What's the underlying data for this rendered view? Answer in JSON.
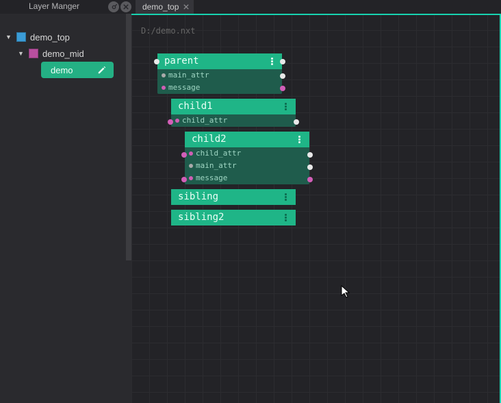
{
  "panel": {
    "title": "Layer Manger"
  },
  "tab": {
    "label": "demo_top"
  },
  "tree": {
    "top": {
      "label": "demo_top"
    },
    "mid": {
      "label": "demo_mid"
    },
    "layer": {
      "label": "demo"
    }
  },
  "canvas": {
    "path": "D:/demo.nxt"
  },
  "nodes": {
    "parent": {
      "title": "parent",
      "attrs": [
        "main_attr",
        "message"
      ]
    },
    "child1": {
      "title": "child1",
      "attrs": [
        "child_attr"
      ]
    },
    "child2": {
      "title": "child2",
      "attrs": [
        "child_attr",
        "main_attr",
        "message"
      ]
    },
    "sibling": {
      "title": "sibling"
    },
    "sibling2": {
      "title": "sibling2"
    }
  }
}
